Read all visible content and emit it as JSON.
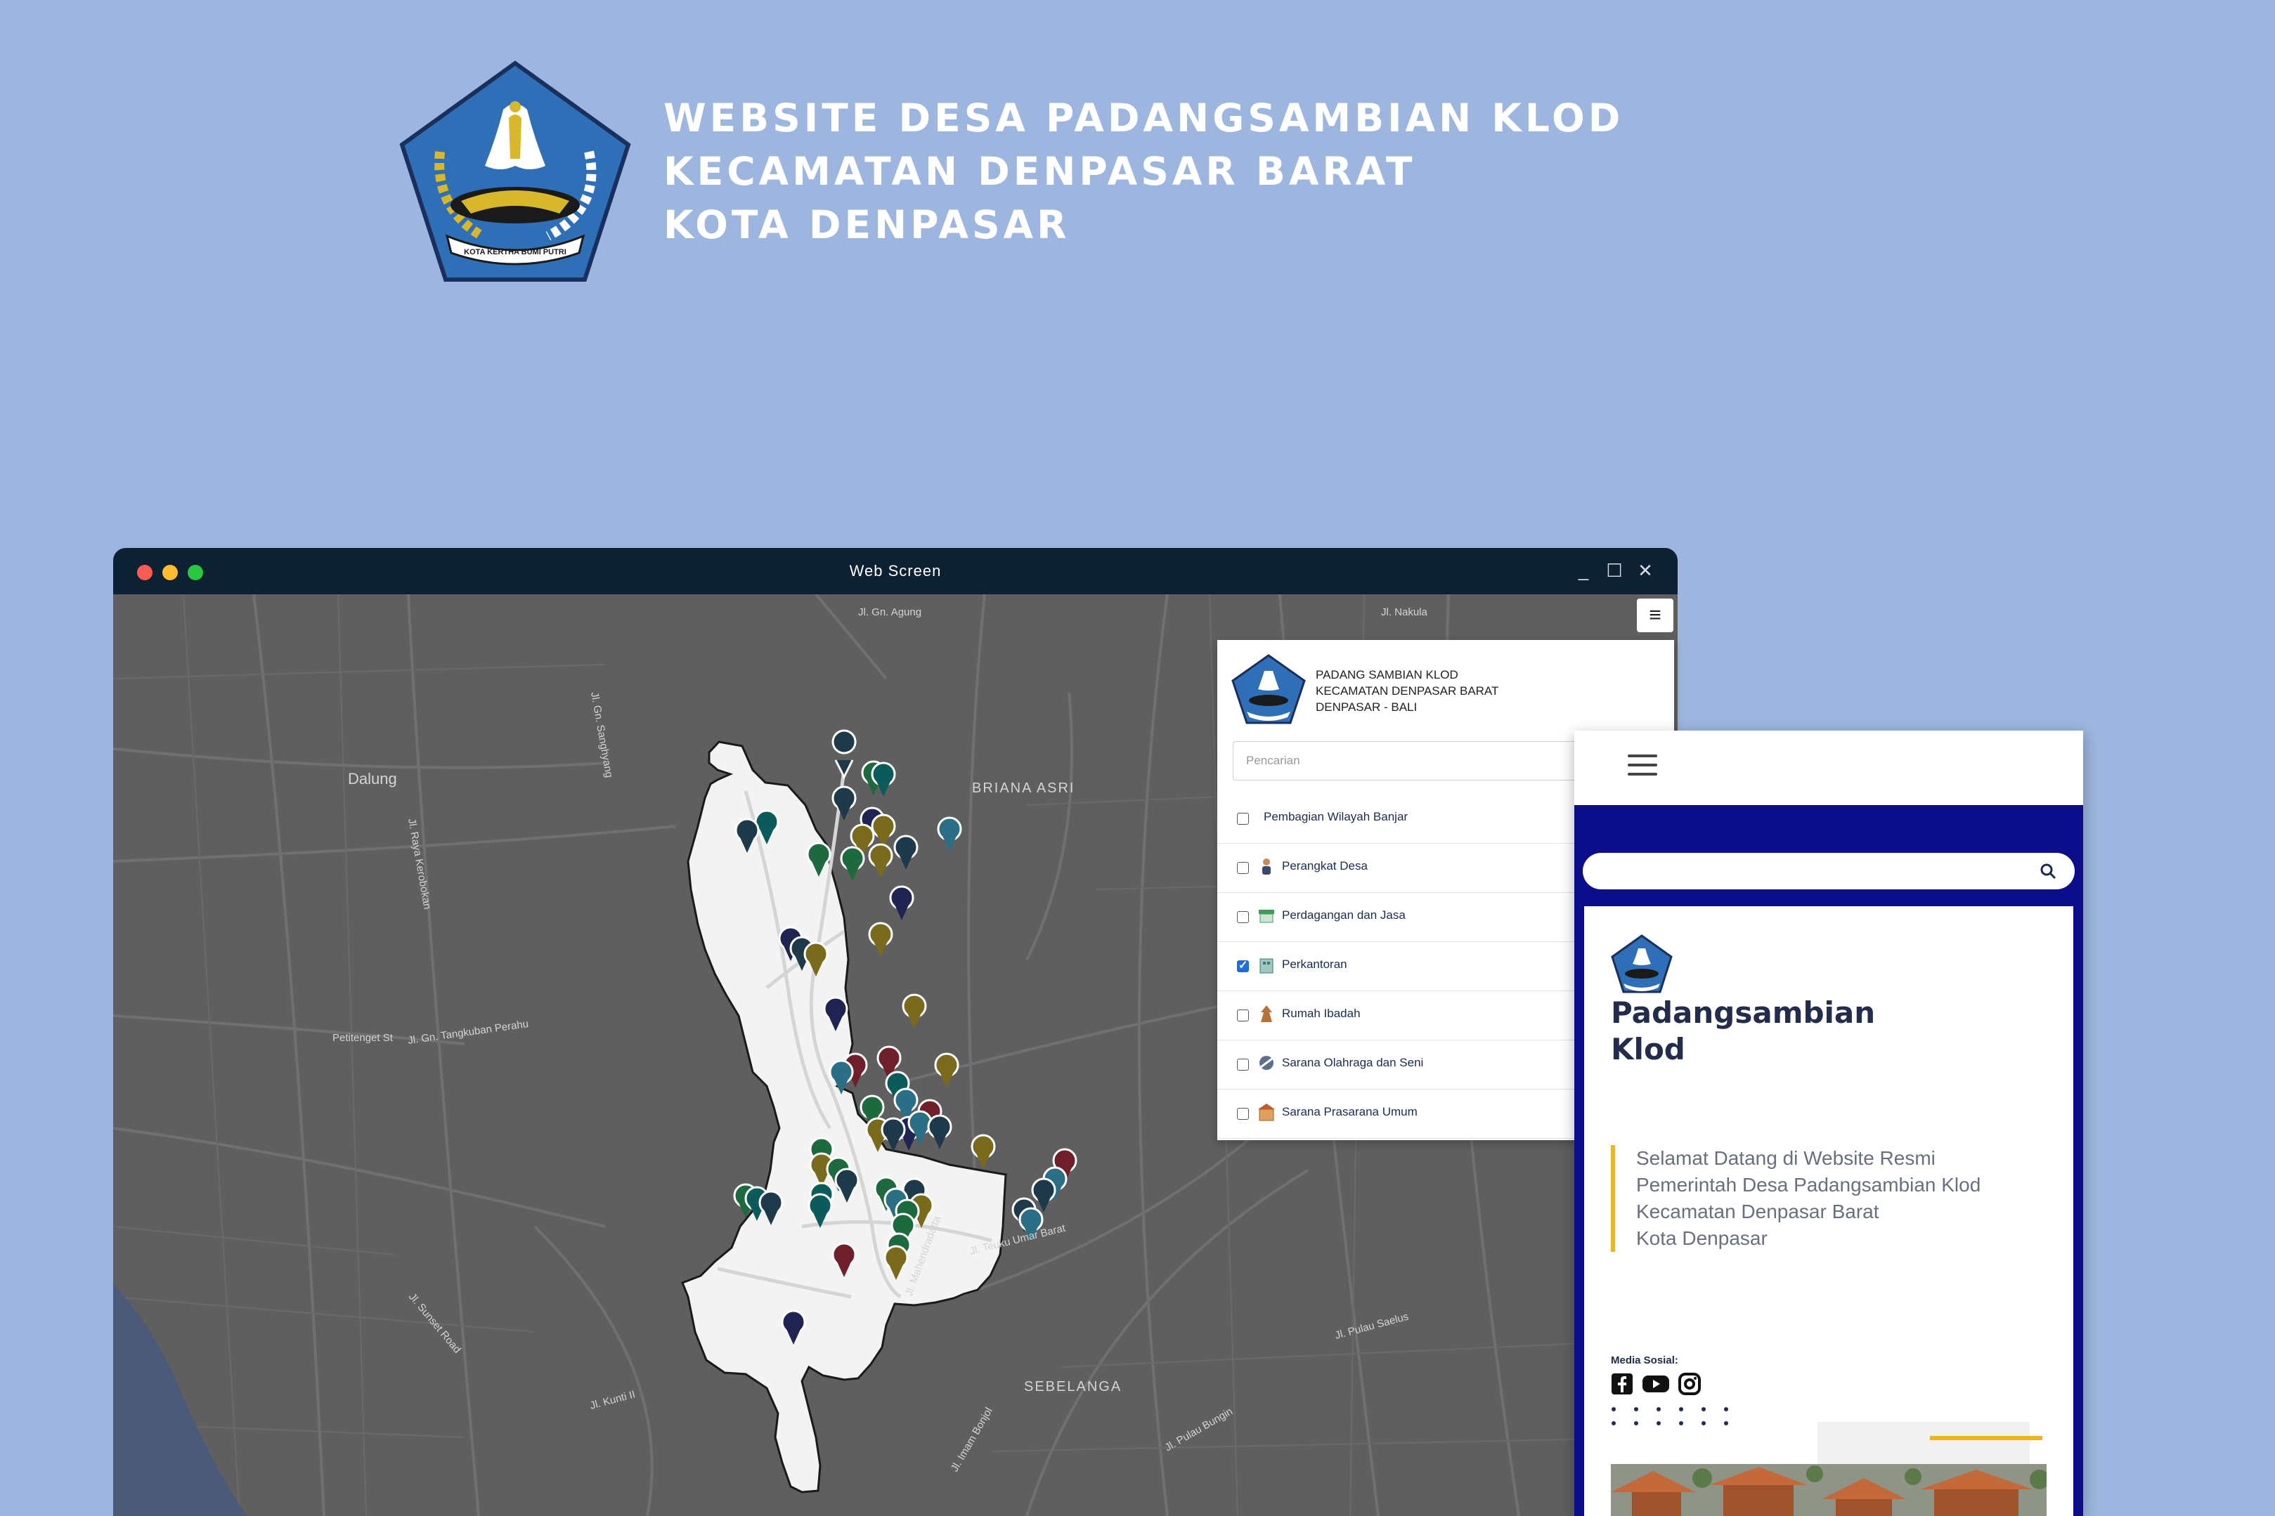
{
  "header": {
    "line1": "WEBSITE DESA PADANGSAMBIAN KLOD",
    "line2": "KECAMATAN DENPASAR BARAT",
    "line3": "KOTA DENPASAR",
    "emblem_icon": "kota-denpasar-emblem-icon",
    "emblem_motto": "KOTA KERTHA BUMI PUTRI"
  },
  "window": {
    "title": "Web Screen",
    "minimize_symbol": "_",
    "maximize_symbol": "☐",
    "close_symbol": "✕"
  },
  "map": {
    "menu_symbol": "≡",
    "labels": [
      "Dalung",
      "BRIANA ASRI",
      "SEBELANGA",
      "Jl. Gn. Agung",
      "Jl. Teuku Umar Barat",
      "Jl. Mahendradatta",
      "Jl. Imam Bonjol",
      "Jl. Pulau Bungin",
      "Jl. Sunset Road",
      "Jl. Gn. Tangkuban Perahu",
      "Petitenget St",
      "Jl. Raya Kerobokan",
      "Jl. Gn. Sanghyang",
      "Jl. Nakula",
      "Jl. Pulau Saelus",
      "Jl. Kunti II"
    ],
    "accent_colors": [
      "#1e3a4a",
      "#0b5b5b",
      "#1d6a3f",
      "#7a6a1c",
      "#6e1f2a",
      "#1f2452",
      "#2b6f86"
    ]
  },
  "panel": {
    "header_line1": "PADANG SAMBIAN KLOD",
    "header_line2": "KECAMATAN DENPASAR BARAT",
    "header_line3": "DENPASAR - BALI",
    "search_placeholder": "Pencarian",
    "layers": [
      {
        "label": "Pembagian Wilayah Banjar",
        "checked": false,
        "icon": ""
      },
      {
        "label": "Perangkat Desa",
        "checked": false,
        "icon": "person-icon"
      },
      {
        "label": "Perdagangan dan Jasa",
        "checked": false,
        "icon": "market-icon"
      },
      {
        "label": "Perkantoran",
        "checked": true,
        "icon": "office-icon"
      },
      {
        "label": "Rumah Ibadah",
        "checked": false,
        "icon": "temple-icon"
      },
      {
        "label": "Sarana Olahraga dan Seni",
        "checked": false,
        "icon": "sports-icon"
      },
      {
        "label": "Sarana Prasarana Umum",
        "checked": false,
        "icon": "public-facility-icon"
      }
    ]
  },
  "mobile": {
    "title_line1": "Padangsambian",
    "title_line2": "Klod",
    "welcome_line1": "Selamat Datang di Website Resmi",
    "welcome_line2": "Pemerintah Desa Padangsambian Klod",
    "welcome_line3": "Kecamatan Denpasar Barat",
    "welcome_line4": "Kota Denpasar",
    "social_label": "Media Sosial:",
    "social_icons": [
      "facebook-icon",
      "youtube-icon",
      "instagram-icon"
    ],
    "accent_color": "#f2b41c",
    "frame_color": "#0b0d8a"
  }
}
